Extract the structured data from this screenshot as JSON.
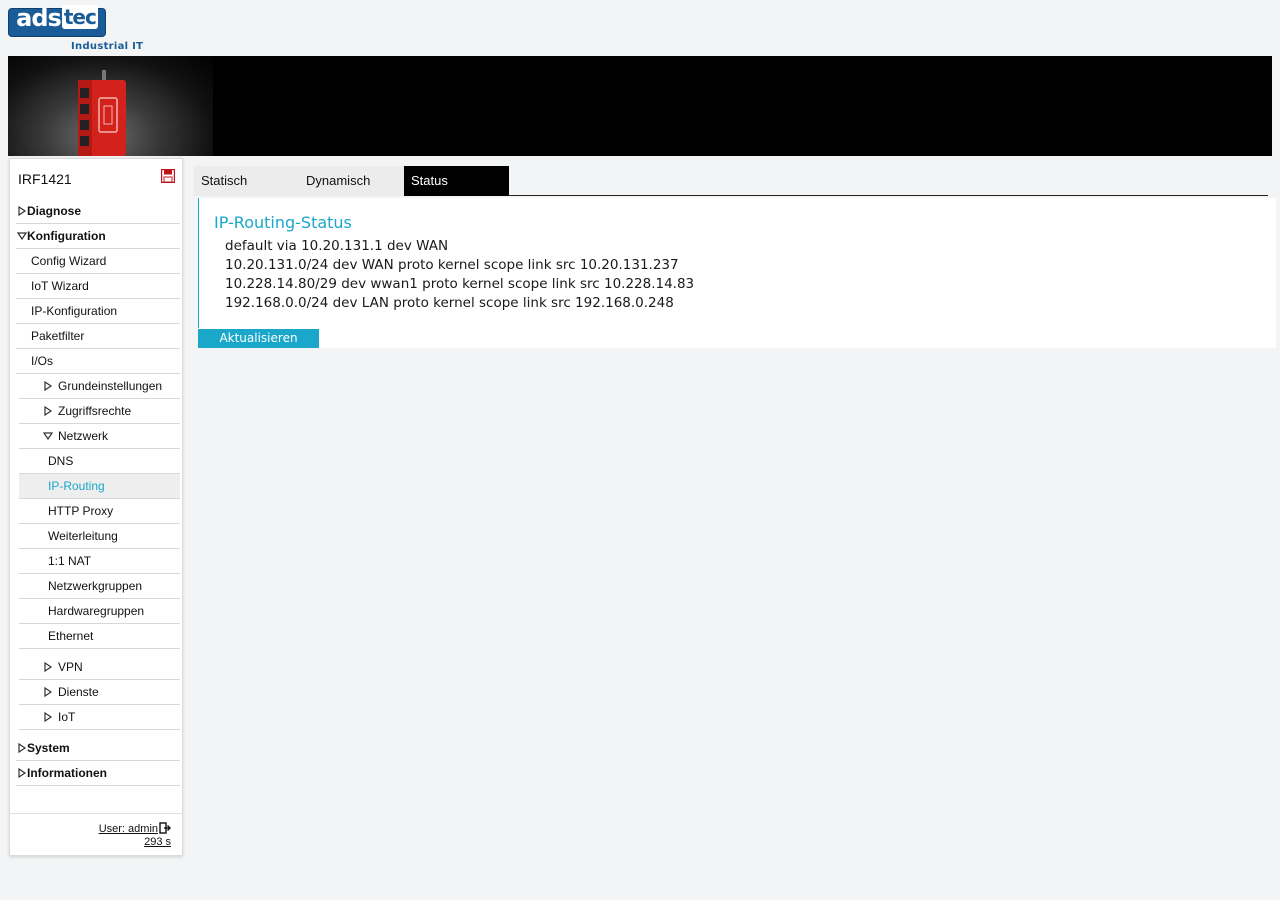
{
  "brand": {
    "logo_main": "ads",
    "logo_tec": "tec",
    "logo_sub": "Industrial IT"
  },
  "sidebar": {
    "device_name": "IRF1421",
    "menu": [
      {
        "label": "Diagnose",
        "level": 0,
        "expanded": false
      },
      {
        "label": "Konfiguration",
        "level": 0,
        "expanded": true
      },
      {
        "label": "Config Wizard",
        "level": 1
      },
      {
        "label": "IoT Wizard",
        "level": 1
      },
      {
        "label": "IP-Konfiguration",
        "level": 1
      },
      {
        "label": "Paketfilter",
        "level": 1
      },
      {
        "label": "I/Os",
        "level": 1
      },
      {
        "label": "Grundeinstellungen",
        "level": 2,
        "expanded": false
      },
      {
        "label": "Zugriffsrechte",
        "level": 2,
        "expanded": false
      },
      {
        "label": "Netzwerk",
        "level": 2,
        "expanded": true
      },
      {
        "label": "DNS",
        "level": 3
      },
      {
        "label": "IP-Routing",
        "level": 3,
        "active": true
      },
      {
        "label": "HTTP Proxy",
        "level": 3
      },
      {
        "label": "Weiterleitung",
        "level": 3
      },
      {
        "label": "1:1 NAT",
        "level": 3
      },
      {
        "label": "Netzwerkgruppen",
        "level": 3
      },
      {
        "label": "Hardwaregruppen",
        "level": 3
      },
      {
        "label": "Ethernet",
        "level": 3
      },
      {
        "label": "VPN",
        "level": 2,
        "expanded": false
      },
      {
        "label": "Dienste",
        "level": 2,
        "expanded": false
      },
      {
        "label": "IoT",
        "level": 2,
        "expanded": false
      },
      {
        "label": "System",
        "level": 0,
        "expanded": false
      },
      {
        "label": "Informationen",
        "level": 0,
        "expanded": false
      }
    ],
    "user_label": "User: admin",
    "timer": "293 s"
  },
  "tabs": [
    {
      "label": "Statisch",
      "active": false
    },
    {
      "label": "Dynamisch",
      "active": false
    },
    {
      "label": "Status",
      "active": true
    }
  ],
  "main": {
    "title": "IP-Routing-Status",
    "routes": [
      "default via 10.20.131.1 dev WAN",
      "10.20.131.0/24 dev WAN proto kernel scope link src 10.20.131.237",
      "10.228.14.80/29 dev wwan1 proto kernel scope link src 10.228.14.83",
      "192.168.0.0/24 dev LAN proto kernel scope link src 192.168.0.248"
    ],
    "refresh_label": "Aktualisieren"
  },
  "colors": {
    "accent": "#1aa7c9",
    "brand_blue": "#1a5c98",
    "save_icon": "#c0141c"
  },
  "icons": {
    "collapsed": "caret-right-icon",
    "expanded": "caret-down-icon",
    "save": "floppy-disk-icon",
    "logout": "logout-icon"
  }
}
